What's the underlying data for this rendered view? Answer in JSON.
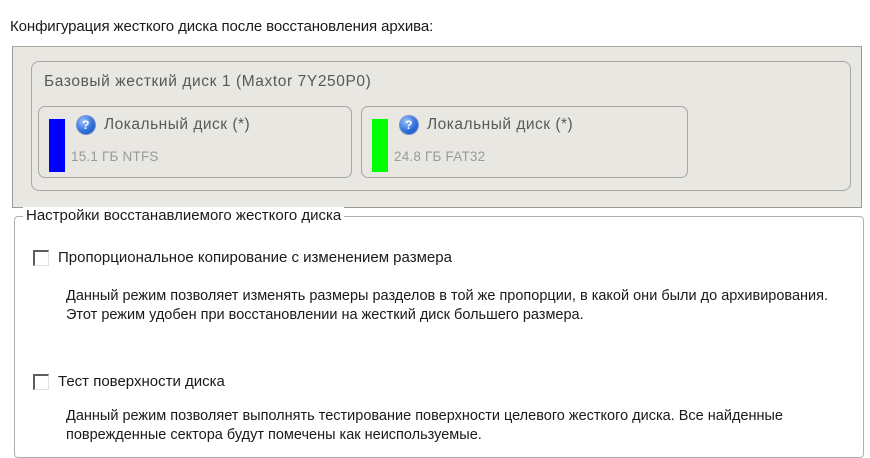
{
  "heading": "Конфигурация жесткого диска после восстановления архива:",
  "disk": {
    "title": "Базовый жесткий диск 1  (Maxtor 7Y250P0)",
    "partitions": [
      {
        "label": "Локальный диск (*)",
        "info": "15.1 ГБ NTFS",
        "color": "#0000ff"
      },
      {
        "label": "Локальный диск (*)",
        "info": "24.8 ГБ FAT32",
        "color": "#00ff00"
      }
    ]
  },
  "settings": {
    "legend": "Настройки восстанавлиемого жесткого диска",
    "options": [
      {
        "label": "Пропорциональное копирование с изменением размера",
        "checked": false,
        "description": "Данный режим позволяет изменять размеры разделов в той же пропорции, в какой они были до архивирования. Этот режим удобен при восстановлении на жесткий диск большего размера."
      },
      {
        "label": "Тест поверхности диска",
        "checked": false,
        "description": "Данный режим позволяет выполнять тестирование поверхности целевого жесткого диска. Все найденные поврежденные сектора будут помечены как неиспользуемые."
      }
    ]
  }
}
